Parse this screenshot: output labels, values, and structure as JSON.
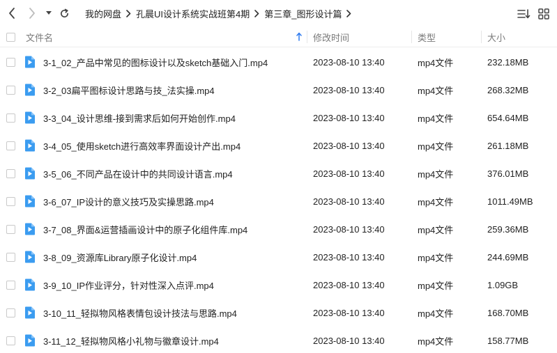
{
  "breadcrumb": {
    "items": [
      "我的网盘",
      "孔晨UI设计系统实战班第4期",
      "第三章_图形设计篇"
    ]
  },
  "columns": {
    "name": "文件名",
    "modified": "修改时间",
    "type": "类型",
    "size": "大小"
  },
  "colors": {
    "accent": "#3b9cf0",
    "sort_arrow": "#2f7bef"
  },
  "icons": {
    "back": "chevron-left-icon",
    "forward": "chevron-right-icon",
    "history": "caret-down-icon",
    "refresh": "refresh-icon",
    "sort": "sort-list-icon",
    "grid": "grid-view-icon",
    "file": "video-file-icon"
  },
  "files": [
    {
      "name": "3-1_02_产品中常见的图标设计以及sketch基础入门.mp4",
      "modified": "2023-08-10 13:40",
      "type": "mp4文件",
      "size": "232.18MB"
    },
    {
      "name": "3-2_03扁平图标设计思路与技_法实操.mp4",
      "modified": "2023-08-10 13:40",
      "type": "mp4文件",
      "size": "268.32MB"
    },
    {
      "name": "3-3_04_设计思维-接到需求后如何开始创作.mp4",
      "modified": "2023-08-10 13:40",
      "type": "mp4文件",
      "size": "654.64MB"
    },
    {
      "name": "3-4_05_使用sketch进行高效率界面设计产出.mp4",
      "modified": "2023-08-10 13:40",
      "type": "mp4文件",
      "size": "261.18MB"
    },
    {
      "name": "3-5_06_不同产品在设计中的共同设计语言.mp4",
      "modified": "2023-08-10 13:40",
      "type": "mp4文件",
      "size": "376.01MB"
    },
    {
      "name": "3-6_07_IP设计的意义技巧及实操思路.mp4",
      "modified": "2023-08-10 13:40",
      "type": "mp4文件",
      "size": "1011.49MB"
    },
    {
      "name": "3-7_08_界面&运营插画设计中的原子化组件库.mp4",
      "modified": "2023-08-10 13:40",
      "type": "mp4文件",
      "size": "259.36MB"
    },
    {
      "name": "3-8_09_资源库Library原子化设计.mp4",
      "modified": "2023-08-10 13:40",
      "type": "mp4文件",
      "size": "244.69MB"
    },
    {
      "name": "3-9_10_IP作业评分，针对性深入点评.mp4",
      "modified": "2023-08-10 13:40",
      "type": "mp4文件",
      "size": "1.09GB"
    },
    {
      "name": "3-10_11_轻拟物风格表情包设计技法与思路.mp4",
      "modified": "2023-08-10 13:40",
      "type": "mp4文件",
      "size": "168.70MB"
    },
    {
      "name": "3-11_12_轻拟物风格小礼物与徽章设计.mp4",
      "modified": "2023-08-10 13:40",
      "type": "mp4文件",
      "size": "158.77MB"
    }
  ]
}
